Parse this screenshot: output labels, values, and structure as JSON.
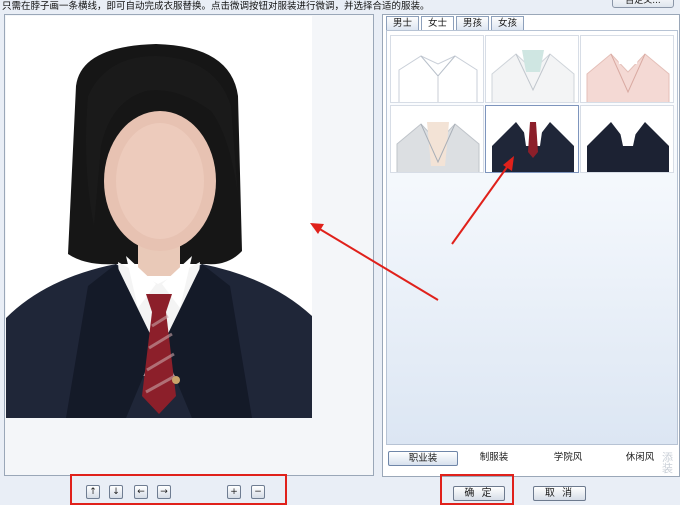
{
  "instruction": "只需在脖子画一条横线，即可自动完成衣服替换。点击微调按钮对服装进行微调，并选择合适的服装。",
  "custom_button_label": "自定义...",
  "tabs": [
    {
      "label": "男士",
      "active": false
    },
    {
      "label": "女士",
      "active": true
    },
    {
      "label": "男孩",
      "active": false
    },
    {
      "label": "女孩",
      "active": false
    }
  ],
  "categories": [
    {
      "label": "职业装",
      "active": true
    },
    {
      "label": "制服装",
      "active": false
    },
    {
      "label": "学院风",
      "active": false
    },
    {
      "label": "休闲风",
      "active": false
    }
  ],
  "watermark": "添装",
  "controls": {
    "move_up": "↑",
    "move_down": "↓",
    "move_left": "←",
    "move_right": "→",
    "zoom_in": "+",
    "zoom_out": "−"
  },
  "actions": {
    "confirm": "确 定",
    "cancel": "取 消"
  },
  "colors": {
    "highlight_red": "#e0211b",
    "suit_navy": "#1f2638",
    "tie_red": "#8c1f2a"
  }
}
